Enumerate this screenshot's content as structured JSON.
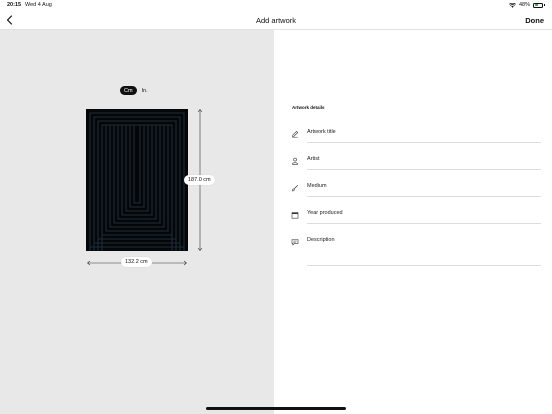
{
  "status_bar": {
    "time": "20:15",
    "date": "Wed 4 Aug",
    "battery": "48%",
    "battery_level": 0.48
  },
  "nav": {
    "title": "Add artwork",
    "done_label": "Done"
  },
  "units": {
    "selected": "Cm",
    "other": "In."
  },
  "dimensions": {
    "height": "187.0 cm",
    "width": "132.2 cm"
  },
  "details": {
    "section_title": "Artwork details",
    "fields": [
      {
        "label": "Artwork title",
        "icon": "pencil-icon"
      },
      {
        "label": "Artist",
        "icon": "person-icon"
      },
      {
        "label": "Medium",
        "icon": "brush-icon"
      },
      {
        "label": "Year produced",
        "icon": "calendar-icon"
      },
      {
        "label": "Description",
        "icon": "comment-icon"
      }
    ]
  },
  "colors": {
    "artwork_background": "#050608",
    "artwork_lines": "#1d2c3a",
    "left_pane": "#e8e8e9",
    "battery_fill": "#2fa84f"
  }
}
